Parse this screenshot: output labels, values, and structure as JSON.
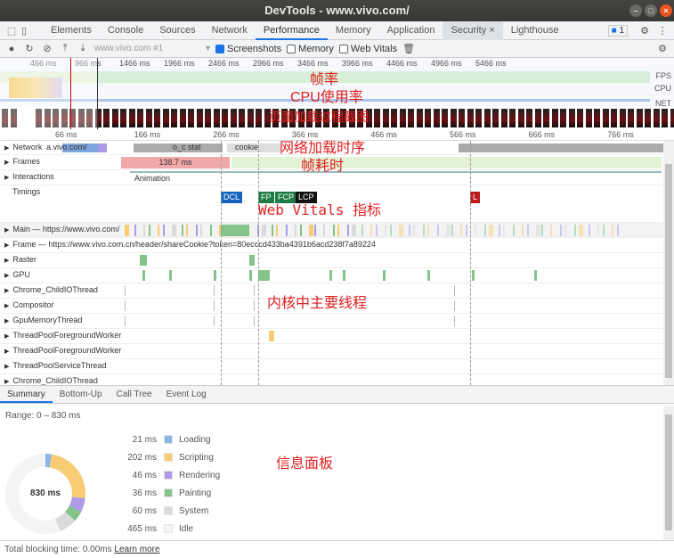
{
  "window": {
    "title": "DevTools - www.vivo.com/"
  },
  "tabs": [
    {
      "label": "Elements"
    },
    {
      "label": "Console"
    },
    {
      "label": "Sources"
    },
    {
      "label": "Network"
    },
    {
      "label": "Performance"
    },
    {
      "label": "Memory"
    },
    {
      "label": "Application"
    },
    {
      "label": "Security"
    },
    {
      "label": "Lighthouse"
    }
  ],
  "active_tab": "Performance",
  "issues_badge": "1",
  "toolbar": {
    "recording_select": "www.vivo.com #1",
    "screenshots_label": "Screenshots",
    "screenshots_checked": true,
    "memory_label": "Memory",
    "memory_checked": false,
    "web_vitals_label": "Web Vitals",
    "web_vitals_checked": false
  },
  "overview": {
    "ticks": [
      "466 ms",
      "966 ms",
      "1466 ms",
      "1966 ms",
      "2466 ms",
      "2966 ms",
      "3466 ms",
      "3966 ms",
      "4466 ms",
      "4966 ms",
      "5466 ms"
    ],
    "fps_label": "FPS",
    "cpu_label": "CPU",
    "net_label": "NET"
  },
  "annotations": {
    "fps": "帧率",
    "cpu": "CPU使用率",
    "screenshots": "页面加载过程截图",
    "network": "网络加载时序",
    "frames": "帧耗时",
    "vitals": "Web Vitals 指标",
    "threads": "内核中主要线程",
    "summary": "信息面板"
  },
  "ruler": [
    "66 ms",
    "166 ms",
    "266 ms",
    "366 ms",
    "466 ms",
    "566 ms",
    "666 ms",
    "766 ms"
  ],
  "tracks": {
    "network": "Network",
    "network_items": [
      "a.vivo.com/",
      "o_c stat",
      "cookie"
    ],
    "frames": "Frames",
    "frame_duration": "138.7 ms",
    "interactions": "Interactions",
    "animation": "Animation",
    "timings": "Timings",
    "markers": [
      "DCL",
      "FP",
      "FCP",
      "LCP",
      "L"
    ],
    "main": "Main — https://www.vivo.com/",
    "frame": "Frame — https://www.vivo.com.cn/header/shareCookie?token=80ecccd433ba4391b6acd238f7a89224",
    "threads": [
      "Raster",
      "GPU",
      "Chrome_ChildIOThread",
      "Compositor",
      "GpuMemoryThread",
      "ThreadPoolForegroundWorker",
      "ThreadPoolForegroundWorker",
      "ThreadPoolServiceThread",
      "Chrome_ChildIOThread"
    ]
  },
  "bottom_tabs": [
    {
      "label": "Summary"
    },
    {
      "label": "Bottom-Up"
    },
    {
      "label": "Call Tree"
    },
    {
      "label": "Event Log"
    }
  ],
  "summary": {
    "range": "Range: 0 – 830 ms",
    "total": "830 ms",
    "items": [
      {
        "value": "21 ms",
        "label": "Loading",
        "color": "#8cb4e6",
        "ms": 21
      },
      {
        "value": "202 ms",
        "label": "Scripting",
        "color": "#f7cc75",
        "ms": 202
      },
      {
        "value": "46 ms",
        "label": "Rendering",
        "color": "#ae9ae8",
        "ms": 46
      },
      {
        "value": "36 ms",
        "label": "Painting",
        "color": "#84c48a",
        "ms": 36
      },
      {
        "value": "60 ms",
        "label": "System",
        "color": "#dadada",
        "ms": 60
      },
      {
        "value": "465 ms",
        "label": "Idle",
        "color": "#f4f4f4",
        "ms": 465
      }
    ]
  },
  "footer": {
    "text": "Total blocking time: 0.00ms",
    "link": "Learn more"
  }
}
